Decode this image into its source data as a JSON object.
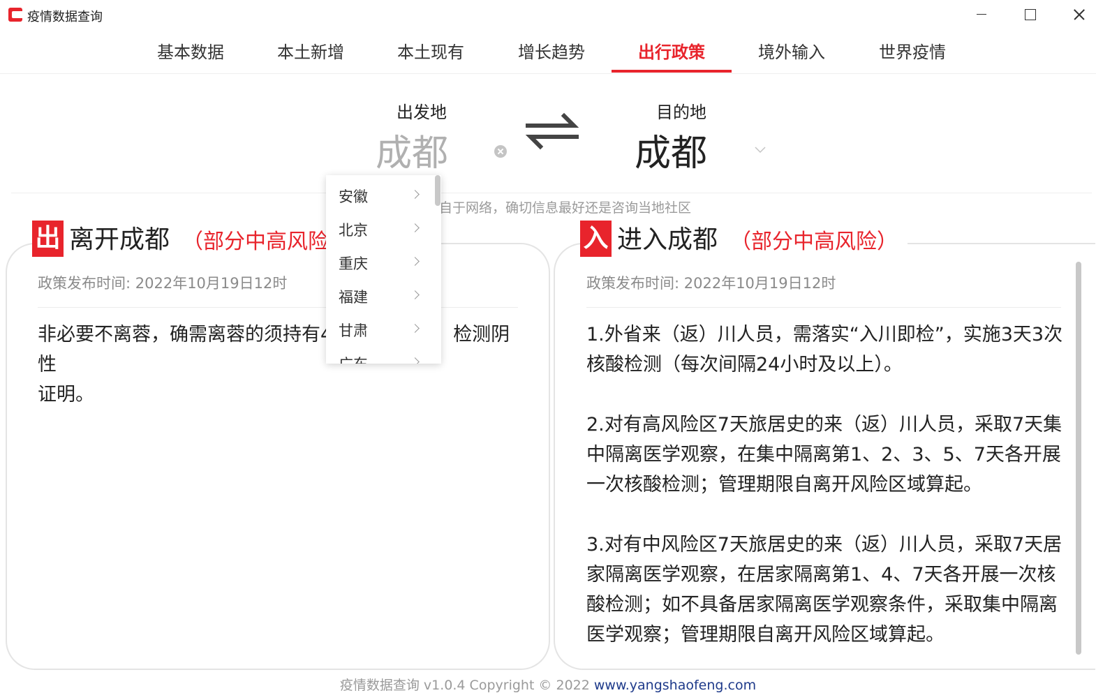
{
  "app": {
    "title": "疫情数据查询"
  },
  "window_controls": [
    "minimize",
    "maximize",
    "close"
  ],
  "tabs": [
    {
      "label": "基本数据",
      "active": false
    },
    {
      "label": "本土新增",
      "active": false
    },
    {
      "label": "本土现有",
      "active": false
    },
    {
      "label": "增长趋势",
      "active": false
    },
    {
      "label": "出行政策",
      "active": true
    },
    {
      "label": "境外输入",
      "active": false
    },
    {
      "label": "世界疫情",
      "active": false
    }
  ],
  "route": {
    "from_label": "出发地",
    "from_value": "成都",
    "to_label": "目的地",
    "to_value": "成都",
    "notice": "自于网络，确切信息最好还是咨询当地社区"
  },
  "province_dropdown": {
    "items": [
      "安徽",
      "北京",
      "重庆",
      "福建",
      "甘肃",
      "广东"
    ]
  },
  "leave_card": {
    "badge": "出",
    "title": "离开成都",
    "risk": "（部分中高风险）",
    "time": "政策发布时间: 2022年10月19日12时",
    "body_lines": [
      "非必要不离蓉，确需离蓉的须持有4",
      "检测阴性",
      "证明。"
    ]
  },
  "enter_card": {
    "badge": "入",
    "title": "进入成都",
    "risk": "（部分中高风险）",
    "time": "政策发布时间: 2022年10月19日12时",
    "paragraphs": [
      "1.外省来（返）川人员，需落实“入川即检”，实施3天3次核酸检测（每次间隔24小时及以上）。",
      "2.对有高风险区7天旅居史的来（返）川人员，采取7天集中隔离医学观察，在集中隔离第1、2、3、5、7天各开展一次核酸检测；管理期限自离开风险区域算起。",
      "3.对有中风险区7天旅居史的来（返）川人员，采取7天居家隔离医学观察，在居家隔离第1、4、7天各开展一次核酸检测；如不具备居家隔离医学观察条件，采取集中隔离医学观察；管理期限自离开风险区域算起。"
    ]
  },
  "footer": {
    "text": "疫情数据查询 v1.0.4 Copyright © 2022 ",
    "link": "www.yangshaofeng.com"
  },
  "colors": {
    "accent": "#e8242c",
    "link": "#1e3a8a",
    "muted": "#9a9a9a"
  },
  "icons": [
    "app-logo-icon",
    "minimize-icon",
    "maximize-icon",
    "close-icon",
    "clear-icon",
    "swap-icon",
    "chevron-down-icon",
    "chevron-right-icon"
  ]
}
